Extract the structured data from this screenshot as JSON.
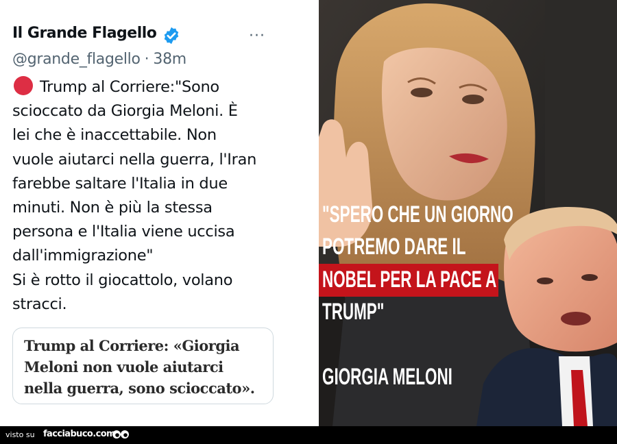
{
  "tweet": {
    "author_name": "Il Grande Flagello",
    "handle": "@grande_flagello",
    "separator": "·",
    "time_ago": "38m",
    "more_label": "···",
    "body_lines": [
      "Trump al Corriere:\"Sono",
      "scioccato da Giorgia Meloni. È",
      "lei che è inaccettabile. Non",
      "vuole aiutarci nella guerra, l'Iran",
      "farebbe saltare l'Italia in due",
      "minuti. Non è più la stessa",
      "persona e l'Italia viene uccisa",
      "dall'immigrazione\"",
      "Si è rotto il giocattolo, volano",
      "stracci."
    ],
    "quote_card_lines": [
      "Trump al Corriere: «Giorgia",
      "Meloni non vuole aiutarci",
      "nella guerra, sono scioccato»."
    ]
  },
  "image_overlay": {
    "quote_lines": [
      "\"SPERO CHE UN GIORNO",
      "POTREMO DARE IL",
      "NOBEL PER LA PACE A",
      "TRUMP\""
    ],
    "attribution": "GIORGIA MELONI",
    "highlight_color": "#c4141b"
  },
  "footer": {
    "visto_label": "visto su",
    "site_name": "facciabuco.com"
  },
  "colors": {
    "verified_blue": "#1d9bf0",
    "red_dot": "#dd2e44",
    "muted_text": "#536471"
  }
}
